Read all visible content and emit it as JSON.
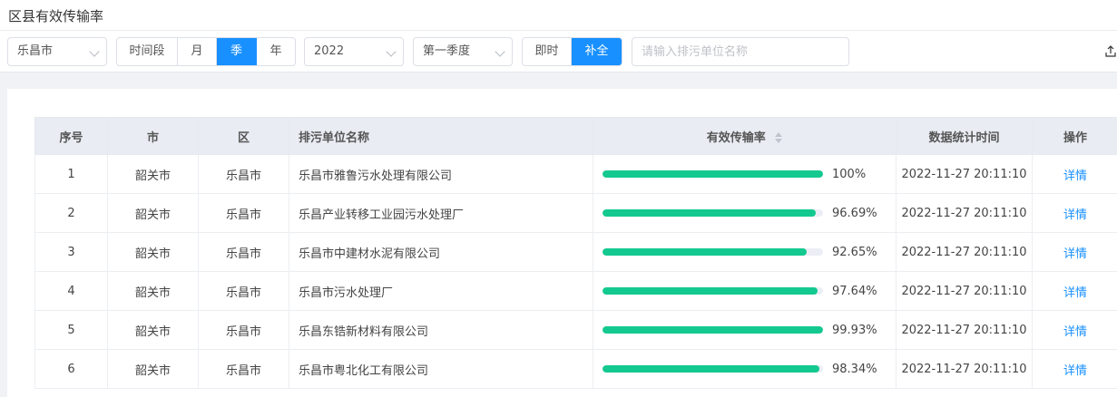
{
  "page": {
    "title": "区县有效传输率"
  },
  "filters": {
    "city": "乐昌市",
    "period_group": [
      {
        "label": "时间段",
        "active": false
      },
      {
        "label": "月",
        "active": false
      },
      {
        "label": "季",
        "active": true
      },
      {
        "label": "年",
        "active": false
      }
    ],
    "year": "2022",
    "quarter": "第一季度",
    "mode_group": [
      {
        "label": "即时",
        "active": false
      },
      {
        "label": "补全",
        "active": true
      }
    ],
    "search_placeholder": "请输入排污单位名称",
    "search_value": ""
  },
  "table": {
    "columns": [
      "序号",
      "市",
      "区",
      "排污单位名称",
      "有效传输率",
      "数据统计时间",
      "操作"
    ],
    "rows": [
      {
        "index": "1",
        "city": "韶关市",
        "district": "乐昌市",
        "name": "乐昌市雅鲁污水处理有限公司",
        "rate": 100,
        "rate_text": "100%",
        "time": "2022-11-27 20:11:10",
        "action": "详情"
      },
      {
        "index": "2",
        "city": "韶关市",
        "district": "乐昌市",
        "name": "乐昌产业转移工业园污水处理厂",
        "rate": 96.69,
        "rate_text": "96.69%",
        "time": "2022-11-27 20:11:10",
        "action": "详情"
      },
      {
        "index": "3",
        "city": "韶关市",
        "district": "乐昌市",
        "name": "乐昌市中建材水泥有限公司",
        "rate": 92.65,
        "rate_text": "92.65%",
        "time": "2022-11-27 20:11:10",
        "action": "详情"
      },
      {
        "index": "4",
        "city": "韶关市",
        "district": "乐昌市",
        "name": "乐昌市污水处理厂",
        "rate": 97.64,
        "rate_text": "97.64%",
        "time": "2022-11-27 20:11:10",
        "action": "详情"
      },
      {
        "index": "5",
        "city": "韶关市",
        "district": "乐昌市",
        "name": "乐昌东锆新材料有限公司",
        "rate": 99.93,
        "rate_text": "99.93%",
        "time": "2022-11-27 20:11:10",
        "action": "详情"
      },
      {
        "index": "6",
        "city": "韶关市",
        "district": "乐昌市",
        "name": "乐昌市粤北化工有限公司",
        "rate": 98.34,
        "rate_text": "98.34%",
        "time": "2022-11-27 20:11:10",
        "action": "详情"
      }
    ]
  },
  "colors": {
    "accent": "#1890ff",
    "progress": "#13c98f",
    "header_bg": "#e9edf3"
  },
  "icons": {
    "sort": "sort-caret-icon",
    "export": "export-icon",
    "chevron": "chevron-down-icon"
  }
}
